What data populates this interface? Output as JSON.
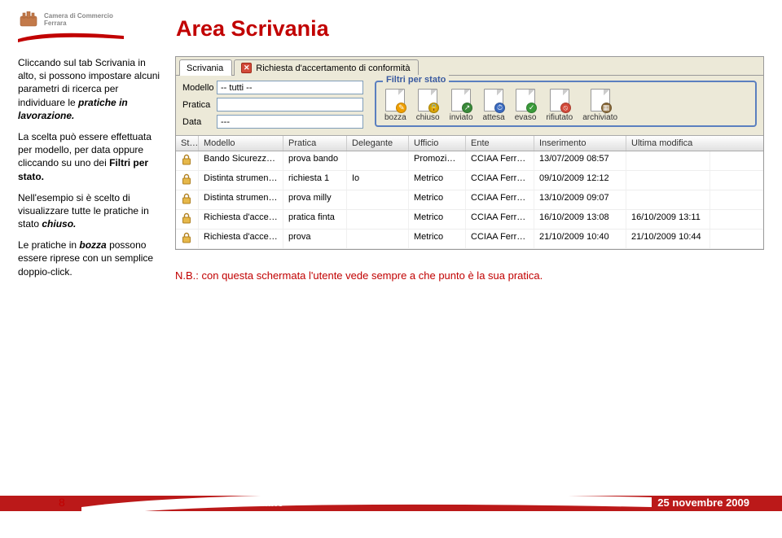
{
  "header": {
    "org": "Camera di Commercio\nFerrara",
    "title": "Area Scrivania"
  },
  "paragraphs": {
    "p1a": "Cliccando sul tab Scrivania in alto, si possono impostare alcuni parametri di ricerca per individuare le ",
    "p1b": "pratiche in lavorazione.",
    "p2a": "La scelta può essere effettuata per modello, per data oppure cliccando su uno dei ",
    "p2b": "Filtri per stato.",
    "p3a": "Nell'esempio si è scelto di visualizzare tutte le pratiche in stato ",
    "p3b": "chiuso.",
    "p4a": "Le pratiche in ",
    "p4b": "bozza",
    "p4c": " possono essere riprese con un semplice doppio-click."
  },
  "nb": "N.B.: con questa schermata l'utente vede sempre a che punto è la sua pratica.",
  "app": {
    "tabs": {
      "scrivania": "Scrivania",
      "richiesta": "Richiesta d'accertamento di conformità"
    },
    "filters": {
      "modello_label": "Modello",
      "modello_value": "-- tutti --",
      "pratica_label": "Pratica",
      "pratica_value": "",
      "data_label": "Data",
      "data_value": "---"
    },
    "stato": {
      "title": "Filtri per stato",
      "items": [
        {
          "label": "bozza",
          "color": "#f0a000",
          "glyph": "✎"
        },
        {
          "label": "chiuso",
          "color": "#d0a000",
          "glyph": "🔒"
        },
        {
          "label": "inviato",
          "color": "#3a8a3a",
          "glyph": "↗"
        },
        {
          "label": "attesa",
          "color": "#3a6abf",
          "glyph": "⏱"
        },
        {
          "label": "evaso",
          "color": "#3a9a3a",
          "glyph": "✓"
        },
        {
          "label": "rifiutato",
          "color": "#d24a3a",
          "glyph": "⦸"
        },
        {
          "label": "archiviato",
          "color": "#8a6a3a",
          "glyph": "▦"
        }
      ]
    },
    "columns": {
      "st": "St…",
      "modello": "Modello",
      "pratica": "Pratica",
      "delegante": "Delegante",
      "ufficio": "Ufficio",
      "ente": "Ente",
      "inserimento": "Inserimento",
      "ultima": "Ultima modifica"
    },
    "rows": [
      {
        "modello": "Bando Sicurezza …",
        "pratica": "prova bando",
        "delegante": "",
        "ufficio": "Promozione",
        "ente": "CCIAA Ferrara",
        "ins": "13/07/2009 08:57",
        "um": ""
      },
      {
        "modello": "Distinta strumenti…",
        "pratica": "richiesta 1",
        "delegante": "Io",
        "ufficio": "Metrico",
        "ente": "CCIAA Ferrara",
        "ins": "09/10/2009 12:12",
        "um": ""
      },
      {
        "modello": "Distinta strumenti…",
        "pratica": "prova milly",
        "delegante": "",
        "ufficio": "Metrico",
        "ente": "CCIAA Ferrara",
        "ins": "13/10/2009 09:07",
        "um": ""
      },
      {
        "modello": "Richiesta d'accert…",
        "pratica": "pratica finta",
        "delegante": "",
        "ufficio": "Metrico",
        "ente": "CCIAA Ferrara",
        "ins": "16/10/2009 13:08",
        "um": "16/10/2009 13:11"
      },
      {
        "modello": "Richiesta d'accert…",
        "pratica": "prova",
        "delegante": "",
        "ufficio": "Metrico",
        "ente": "CCIAA Ferrara",
        "ins": "21/10/2009 10:40",
        "um": "21/10/2009 10:44"
      }
    ]
  },
  "footer": {
    "page": "8",
    "title": "Modulistica on-line",
    "date": "25 novembre 2009"
  }
}
